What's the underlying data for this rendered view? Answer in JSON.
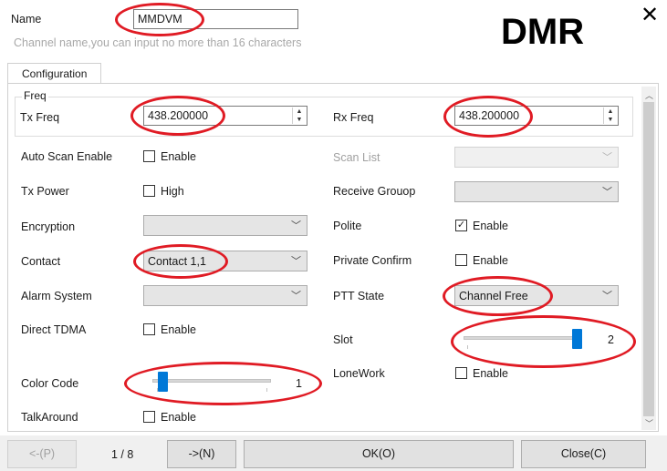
{
  "header": {
    "name_label": "Name",
    "name_value": "MMDVM",
    "name_hint": "Channel name,you can input no more than 16 characters",
    "mode_title": "DMR",
    "close_glyph": "✕"
  },
  "tabs": [
    {
      "label": "Configuration",
      "active": true
    }
  ],
  "freq": {
    "group_label": "Freq",
    "tx_label": "Tx Freq",
    "tx_value": "438.200000",
    "rx_label": "Rx Freq",
    "rx_value": "438.200000"
  },
  "left": {
    "auto_scan_label": "Auto Scan Enable",
    "auto_scan_check": "Enable",
    "auto_scan_checked": false,
    "tx_power_label": "Tx Power",
    "tx_power_check": "High",
    "tx_power_checked": false,
    "encryption_label": "Encryption",
    "encryption_value": "",
    "contact_label": "Contact",
    "contact_value": "Contact 1,1",
    "alarm_label": "Alarm System",
    "alarm_value": "",
    "direct_tdma_label": "Direct TDMA",
    "direct_tdma_check": "Enable",
    "direct_tdma_checked": false,
    "color_code_label": "Color Code",
    "color_code_value": "1",
    "talkaround_label": "TalkAround",
    "talkaround_check": "Enable",
    "talkaround_checked": false
  },
  "right": {
    "scan_list_label": "Scan List",
    "scan_list_value": "",
    "receive_group_label": "Receive Grouop",
    "receive_group_value": "",
    "polite_label": "Polite",
    "polite_check": "Enable",
    "polite_checked": true,
    "private_confirm_label": "Private Confirm",
    "private_confirm_check": "Enable",
    "private_confirm_checked": false,
    "ptt_state_label": "PTT State",
    "ptt_state_value": "Channel Free",
    "slot_label": "Slot",
    "slot_value": "2",
    "lonework_label": "LoneWork",
    "lonework_check": "Enable",
    "lonework_checked": false
  },
  "footer": {
    "prev_label": "<-(P)",
    "page_indicator": "1 / 8",
    "next_label": "->(N)",
    "ok_label": "OK(O)",
    "close_label": "Close(C)"
  },
  "colors": {
    "annotation": "#e01b24",
    "slider_thumb": "#0078d7",
    "panel_bg": "#ffffff",
    "footer_bg": "#f0f0f0"
  }
}
